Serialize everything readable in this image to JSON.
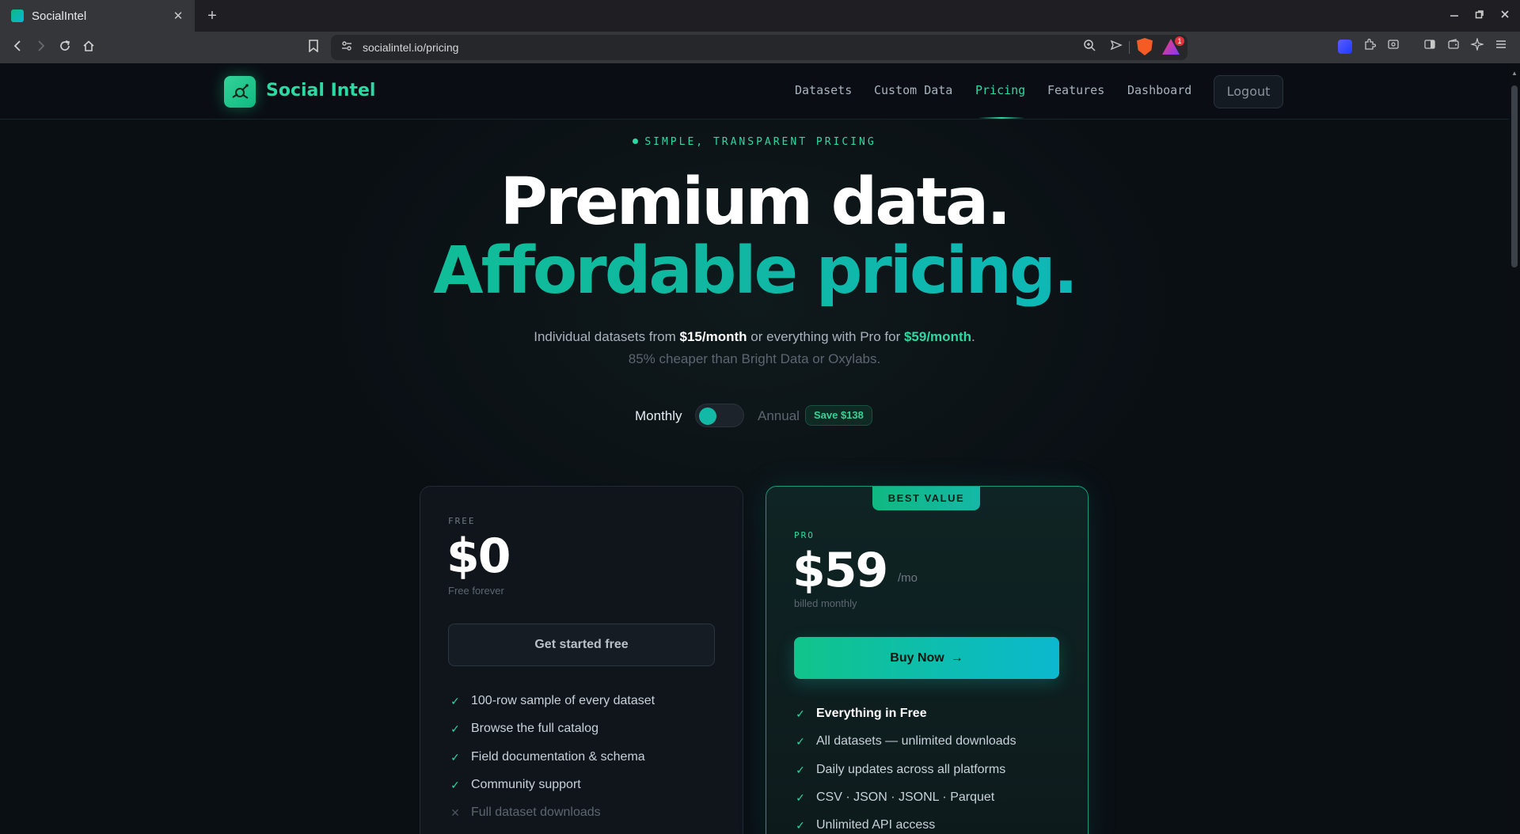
{
  "browser": {
    "tab_title": "SocialIntel",
    "tab_close": "✕",
    "new_tab": "+",
    "url": "socialintel.io/pricing",
    "rewards_count": "1"
  },
  "site": {
    "brand": "Social Intel",
    "nav": [
      {
        "label": "Datasets"
      },
      {
        "label": "Custom Data"
      },
      {
        "label": "Pricing",
        "active": true
      },
      {
        "label": "Features"
      },
      {
        "label": "Dashboard"
      }
    ],
    "logout": "Logout"
  },
  "hero": {
    "eyebrow": "SIMPLE, TRANSPARENT PRICING",
    "line1": "Premium data.",
    "line2": "Affordable pricing.",
    "sub_prefix": "Individual datasets from ",
    "sub_price1": "$15/month",
    "sub_mid": " or everything with Pro for ",
    "sub_price2": "$59/month",
    "sub_suffix": ".",
    "sub2": "85% cheaper than Bright Data or Oxylabs."
  },
  "billing": {
    "monthly": "Monthly",
    "annual": "Annual",
    "save_badge": "Save $138",
    "selected": "Monthly"
  },
  "plans": {
    "free": {
      "label": "FREE",
      "price": "$0",
      "note": "Free forever",
      "cta": "Get started free",
      "features": [
        {
          "text": "100-row sample of every dataset",
          "included": true
        },
        {
          "text": "Browse the full catalog",
          "included": true
        },
        {
          "text": "Field documentation & schema",
          "included": true
        },
        {
          "text": "Community support",
          "included": true
        },
        {
          "text": "Full dataset downloads",
          "included": false
        }
      ]
    },
    "pro": {
      "badge": "BEST VALUE",
      "label": "PRO",
      "price": "$59",
      "per": "/mo",
      "note": "billed monthly",
      "cta": "Buy Now",
      "cta_arrow": "→",
      "features": [
        {
          "text": "Everything in Free",
          "included": true
        },
        {
          "text": "All datasets — unlimited downloads",
          "included": true
        },
        {
          "text": "Daily updates across all platforms",
          "included": true
        },
        {
          "text": "CSV · JSON · JSONL · Parquet",
          "included": true
        },
        {
          "text": "Unlimited API access",
          "included": true
        }
      ]
    }
  },
  "colors": {
    "accent": "#2ed8a3",
    "teal": "#14b8a6",
    "background": "#0a0f14"
  }
}
